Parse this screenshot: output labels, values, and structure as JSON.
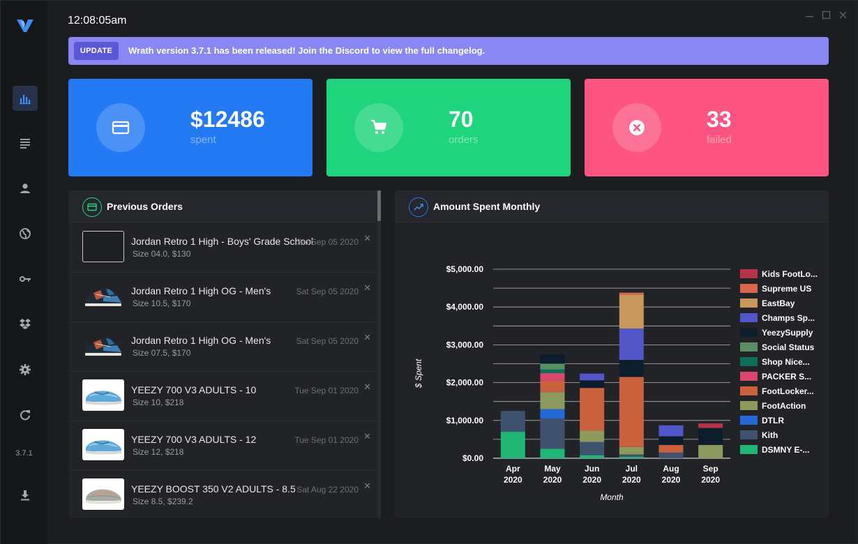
{
  "app": {
    "time": "12:08:05am",
    "version": "3.7.1"
  },
  "update": {
    "badge": "UPDATE",
    "message": "Wrath version 3.7.1 has been released! Join the Discord to view the full changelog."
  },
  "stats": {
    "spent": {
      "value": "$12486",
      "label": "spent",
      "color": "#2479f5"
    },
    "orders": {
      "value": "70",
      "label": "orders",
      "color": "#1ed47c"
    },
    "failed": {
      "value": "33",
      "label": "failed",
      "color": "#fd5481"
    }
  },
  "sidebar": {
    "items": [
      {
        "name": "dashboard",
        "icon": "bar-chart-icon",
        "active": true
      },
      {
        "name": "tasks",
        "icon": "list-icon"
      },
      {
        "name": "profiles",
        "icon": "user-icon"
      },
      {
        "name": "proxies",
        "icon": "globe-icon"
      },
      {
        "name": "accounts",
        "icon": "key-icon"
      },
      {
        "name": "products",
        "icon": "dropbox-icon"
      },
      {
        "name": "settings",
        "icon": "gear-icon"
      },
      {
        "name": "refresh",
        "icon": "refresh-icon"
      },
      {
        "name": "download",
        "icon": "download-icon"
      }
    ]
  },
  "orders_panel": {
    "title": "Previous Orders",
    "orders": [
      {
        "name": "Jordan Retro 1 High - Boys' Grade School",
        "meta": "Size 04.0, $130",
        "date": "Sat Sep 05 2020",
        "thumb": "broken"
      },
      {
        "name": "Jordan Retro 1 High OG - Men's",
        "meta": "Size 10.5, $170",
        "date": "Sat Sep 05 2020",
        "thumb": "jordan"
      },
      {
        "name": "Jordan Retro 1 High OG - Men's",
        "meta": "Size 07.5, $170",
        "date": "Sat Sep 05 2020",
        "thumb": "jordan"
      },
      {
        "name": "YEEZY 700 V3 ADULTS - 10",
        "meta": "Size 10, $218",
        "date": "Tue Sep 01 2020",
        "thumb": "yeezy700"
      },
      {
        "name": "YEEZY 700 V3 ADULTS - 12",
        "meta": "Size 12, $218",
        "date": "Tue Sep 01 2020",
        "thumb": "yeezy700"
      },
      {
        "name": "YEEZY BOOST 350 V2 ADULTS - 8.5",
        "meta": "Size 8.5, $239.2",
        "date": "Sat Aug 22 2020",
        "thumb": "yeezy350"
      }
    ]
  },
  "chart_panel": {
    "title": "Amount Spent Monthly"
  },
  "chart_data": {
    "type": "bar",
    "stacked": true,
    "categories": [
      [
        "Apr",
        "2020"
      ],
      [
        "May",
        "2020"
      ],
      [
        "Jun",
        "2020"
      ],
      [
        "Jul",
        "2020"
      ],
      [
        "Aug",
        "2020"
      ],
      [
        "Sep",
        "2020"
      ]
    ],
    "xlabel": "Month",
    "ylabel": "$ Spent",
    "ylim": [
      0,
      5000
    ],
    "yticks": [
      "$0.00",
      "$1,000.00",
      "$2,000.00",
      "$3,000.00",
      "$4,000.00",
      "$5,000.00"
    ],
    "legend_position": "right",
    "series": [
      {
        "name": "DSMNY E-...",
        "color": "#1fb574",
        "values": [
          700,
          250,
          80,
          40,
          0,
          0
        ]
      },
      {
        "name": "Kith",
        "color": "#3f526e",
        "values": [
          550,
          800,
          350,
          60,
          150,
          0
        ]
      },
      {
        "name": "DTLR",
        "color": "#2569d6",
        "values": [
          0,
          250,
          0,
          0,
          0,
          0
        ]
      },
      {
        "name": "FootAction",
        "color": "#8d9a5d",
        "values": [
          0,
          450,
          300,
          200,
          0,
          350
        ]
      },
      {
        "name": "FootLocker...",
        "color": "#c9613f",
        "values": [
          0,
          300,
          1130,
          1850,
          200,
          0
        ]
      },
      {
        "name": "PACKER S...",
        "color": "#d9476d",
        "values": [
          0,
          200,
          0,
          0,
          0,
          0
        ]
      },
      {
        "name": "Shop Nice...",
        "color": "#0f6e5a",
        "values": [
          0,
          100,
          0,
          0,
          0,
          0
        ]
      },
      {
        "name": "Social Status",
        "color": "#5a8f63",
        "values": [
          0,
          150,
          0,
          0,
          0,
          0
        ]
      },
      {
        "name": "YeezySupply",
        "color": "#0c1d2c",
        "values": [
          0,
          250,
          200,
          450,
          230,
          450
        ]
      },
      {
        "name": "Champs Sp...",
        "color": "#5157c9",
        "values": [
          0,
          0,
          180,
          830,
          290,
          0
        ]
      },
      {
        "name": "EastBay",
        "color": "#c8975b",
        "values": [
          0,
          0,
          0,
          900,
          0,
          0
        ]
      },
      {
        "name": "Supreme US",
        "color": "#d9654b",
        "values": [
          0,
          0,
          0,
          50,
          0,
          0
        ]
      },
      {
        "name": "Kids FootLo...",
        "color": "#b73446",
        "values": [
          0,
          0,
          0,
          0,
          0,
          120
        ]
      }
    ],
    "legend_order": [
      "Kids FootLo...",
      "Supreme US",
      "EastBay",
      "Champs Sp...",
      "YeezySupply",
      "Social Status",
      "Shop Nice...",
      "PACKER S...",
      "FootLocker...",
      "FootAction",
      "DTLR",
      "Kith",
      "DSMNY E-..."
    ]
  }
}
